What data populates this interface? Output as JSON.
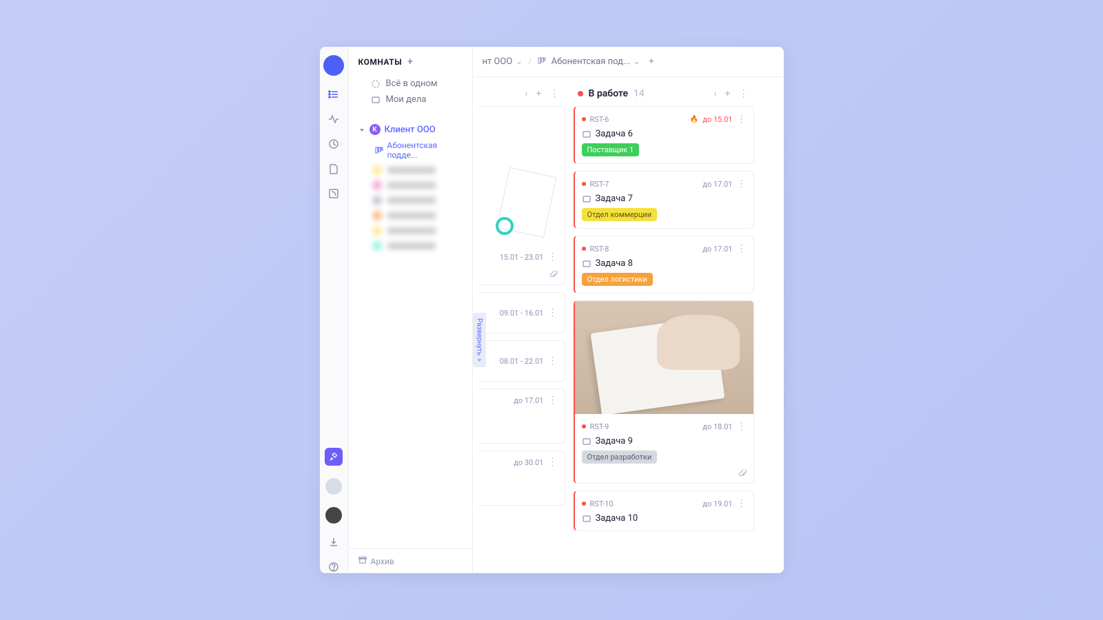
{
  "rooms": {
    "header": "КОМНАТЫ",
    "quick": [
      "Всё в одном",
      "Мои дела"
    ],
    "client": {
      "badge": "К",
      "name": "Клиент ООО",
      "sub": "Абонентская подде..."
    },
    "archive": "Архив"
  },
  "blur_dots": [
    "#fddc5c",
    "#f472b6",
    "#9ca3af",
    "#fb923c",
    "#fddc5c",
    "#5eead4"
  ],
  "breadcrumb": {
    "a": "нт ООО",
    "b": "Абонентская под...",
    "plus": "+"
  },
  "col_first": {
    "entries": [
      {
        "illus": true,
        "range": "15.01 - 23.01"
      },
      {
        "range": "09.01 - 16.01"
      },
      {
        "range": "08.01 - 22.01"
      },
      {
        "due": "до 17.01"
      },
      {
        "due": "до 30.01"
      }
    ]
  },
  "col_work": {
    "title": "В работе",
    "count": "14",
    "dot": "#ff4d4d",
    "cards": [
      {
        "key": "RST-6",
        "title": "Задача 6",
        "due": "до 15.01",
        "fire": true,
        "tag": {
          "text": "Поставщик 1",
          "cls": "green"
        }
      },
      {
        "key": "RST-7",
        "title": "Задача 7",
        "due": "до 17.01",
        "tag": {
          "text": "Отдел коммерции",
          "cls": "yellow"
        }
      },
      {
        "key": "RST-8",
        "title": "Задача 8",
        "due": "до 17.01",
        "tag": {
          "text": "Отдел логистики",
          "cls": "orange"
        }
      },
      {
        "key": "RST-9",
        "title": "Задача 9",
        "due": "до 18.01",
        "img": true,
        "tag": {
          "text": "Отдел разработки",
          "cls": "grey"
        },
        "clip": true
      },
      {
        "key": "RST-10",
        "title": "Задача 10",
        "due": "до 19.01"
      }
    ]
  },
  "expand": "Развернуть"
}
